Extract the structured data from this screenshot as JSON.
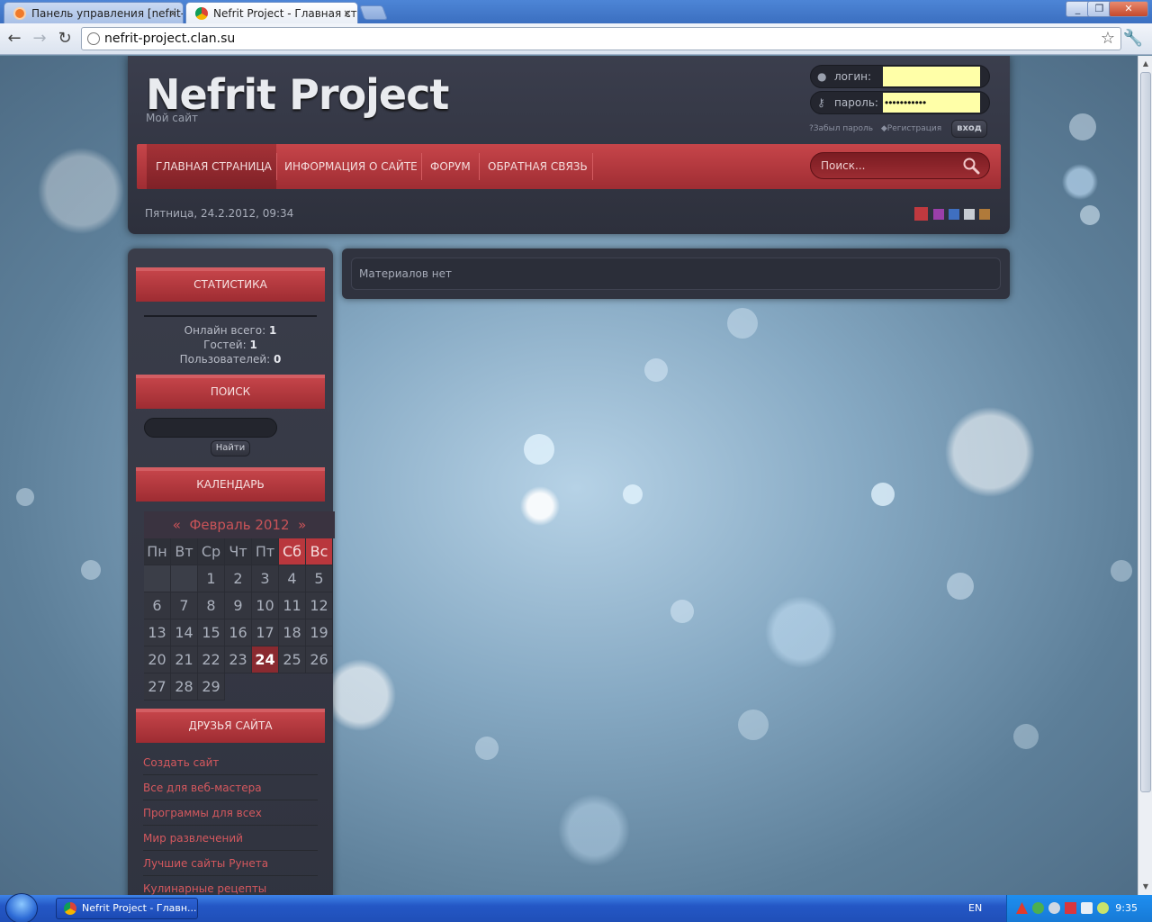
{
  "browser": {
    "tabs": [
      {
        "title": "Панель управления [nefrit-pr",
        "close": "×",
        "active": false
      },
      {
        "title": "Nefrit Project - Главная стра",
        "close": "×",
        "active": true
      }
    ],
    "url": "nefrit-project.clan.su",
    "window_buttons": [
      "_",
      "❐",
      "✕"
    ]
  },
  "site": {
    "logo": "Nefrit Project",
    "subtitle": "Мой сайт",
    "login": {
      "login_label": "логин:",
      "password_label": "пароль:",
      "password_value": "•••••••••••",
      "forgot": "?Забыл пароль",
      "register": "◆Регистрация",
      "submit": "вход"
    },
    "nav": [
      {
        "label": "ГЛАВНАЯ СТРАНИЦА",
        "active": true
      },
      {
        "label": "ИНФОРМАЦИЯ О САЙТЕ",
        "active": false
      },
      {
        "label": "ФОРУМ",
        "active": false
      },
      {
        "label": "ОБРАТНАЯ СВЯЗЬ",
        "active": false
      }
    ],
    "search_placeholder": "Поиск...",
    "date": "Пятница, 24.2.2012, 09:34",
    "theme_swatches": [
      "#c0393f",
      "#9b3fa9",
      "#3f6fc0",
      "#c8ccd2",
      "#b07a3a"
    ]
  },
  "sidebar": {
    "stats": {
      "title": "СТАТИСТИКА",
      "online_label": "Онлайн всего:",
      "online_value": "1",
      "guests_label": "Гостей:",
      "guests_value": "1",
      "users_label": "Пользователей:",
      "users_value": "0"
    },
    "search": {
      "title": "ПОИСК",
      "button": "Найти"
    },
    "calendar": {
      "title": "КАЛЕНДАРЬ",
      "prev": "«",
      "month": "Февраль 2012",
      "next": "»",
      "weekdays": [
        "Пн",
        "Вт",
        "Ср",
        "Чт",
        "Пт",
        "Сб",
        "Вс"
      ],
      "weeks": [
        [
          "",
          "",
          "1",
          "2",
          "3",
          "4",
          "5"
        ],
        [
          "6",
          "7",
          "8",
          "9",
          "10",
          "11",
          "12"
        ],
        [
          "13",
          "14",
          "15",
          "16",
          "17",
          "18",
          "19"
        ],
        [
          "20",
          "21",
          "22",
          "23",
          "24",
          "25",
          "26"
        ],
        [
          "27",
          "28",
          "29",
          "",
          "",
          "",
          ""
        ]
      ],
      "today": "24"
    },
    "friends": {
      "title": "ДРУЗЬЯ САЙТА",
      "links": [
        "Создать сайт",
        "Все для веб-мастера",
        "Программы для всех",
        "Мир развлечений",
        "Лучшие сайты Рунета",
        "Кулинарные рецепты"
      ]
    }
  },
  "content": {
    "message": "Материалов нет"
  },
  "taskbar": {
    "task_title": "Nefrit Project - Главн...",
    "lang": "EN",
    "clock": "9:35"
  }
}
